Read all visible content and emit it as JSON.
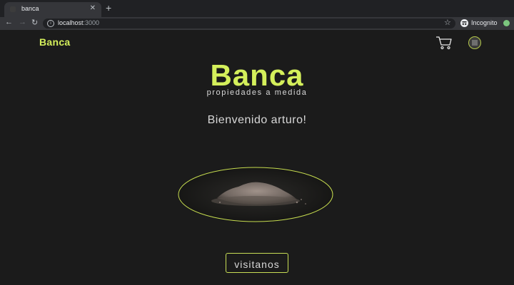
{
  "browser": {
    "tab_title": "banca",
    "url_host": "localhost",
    "url_port": ":3000",
    "profile_label": "Incognito"
  },
  "nav": {
    "logo": "Banca"
  },
  "hero": {
    "logo": "Banca",
    "tagline": "propiedades a medida",
    "welcome": "Bienvenido arturo!",
    "cta_label": "visitanos"
  },
  "colors": {
    "accent": "#d4ef5b",
    "background": "#1b1b1b",
    "text": "#d8d8d8"
  }
}
